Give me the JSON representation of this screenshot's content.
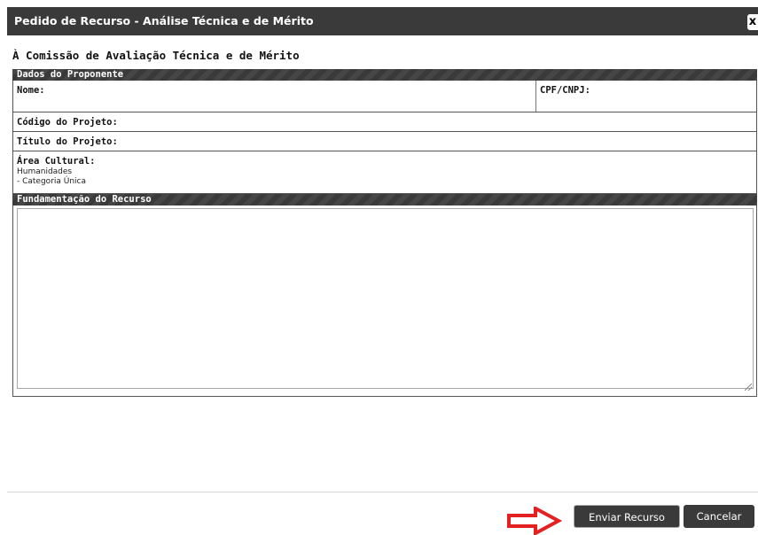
{
  "dialog": {
    "title": "Pedido de Recurso - Análise Técnica e de Mérito",
    "close_label": "x"
  },
  "heading": "À Comissão de Avaliação Técnica e de Mérito",
  "proponente": {
    "section_title": "Dados do Proponente",
    "nome_label": "Nome:",
    "cpf_label": "CPF/CNPJ:",
    "codigo_label": "Código do Projeto:",
    "titulo_label": "Título do Projeto:",
    "area_label": "Área Cultural:",
    "area_value": "Humanidades",
    "categoria_value": "- Categoria Única"
  },
  "fundamentacao": {
    "section_title": "Fundamentação do Recurso",
    "value": ""
  },
  "buttons": {
    "enviar": "Enviar Recurso",
    "cancelar": "Cancelar"
  },
  "colors": {
    "header_bg": "#3a3a3a",
    "arrow": "#e52020"
  },
  "icons": {
    "close": "close-icon",
    "arrow": "red-arrow-icon"
  }
}
